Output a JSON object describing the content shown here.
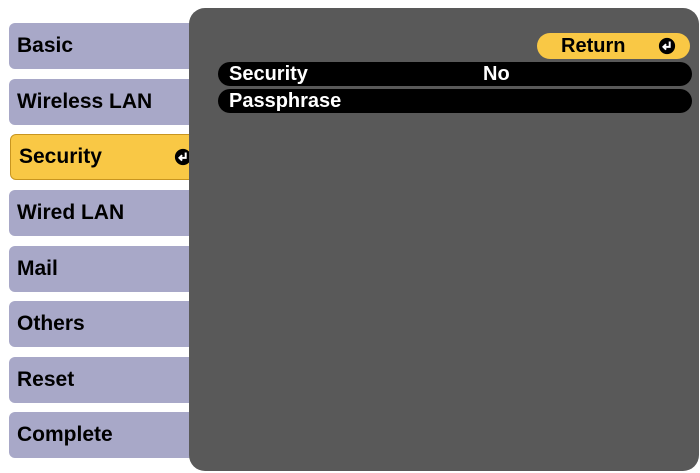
{
  "colors": {
    "sidebar_item_bg": "#a8a8c8",
    "sidebar_active_bg": "#f9c845",
    "panel_bg": "#595959",
    "row_bg": "#000000",
    "row_text": "#ffffff",
    "button_bg": "#f9c845"
  },
  "sidebar": {
    "items": [
      {
        "label": "Basic"
      },
      {
        "label": "Wireless LAN"
      },
      {
        "label": "Security",
        "active": true,
        "icon": "enter-icon"
      },
      {
        "label": "Wired LAN"
      },
      {
        "label": "Mail"
      },
      {
        "label": "Others"
      },
      {
        "label": "Reset"
      },
      {
        "label": "Complete"
      }
    ]
  },
  "panel": {
    "return_label": "Return",
    "return_icon": "enter-icon",
    "rows": [
      {
        "label": "Security",
        "value": "No"
      },
      {
        "label": "Passphrase",
        "value": ""
      }
    ]
  }
}
